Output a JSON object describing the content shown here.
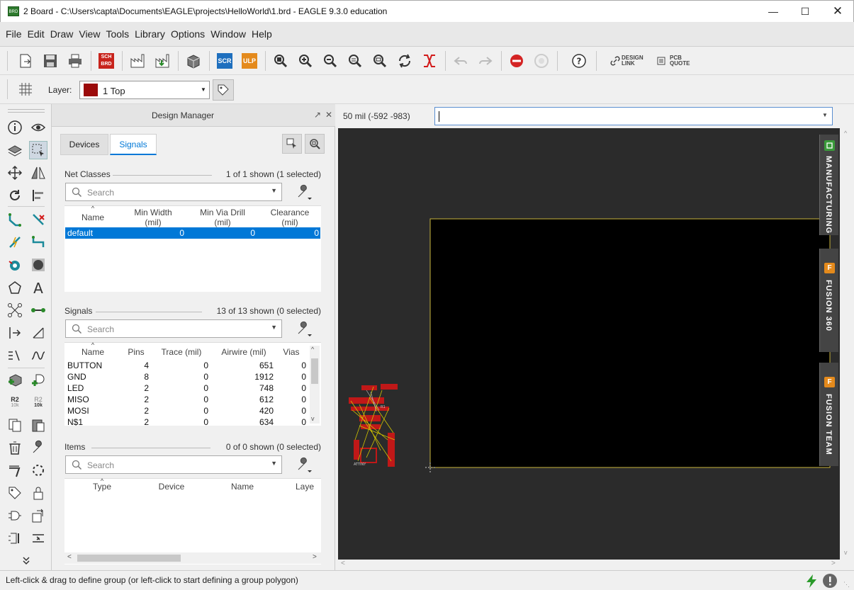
{
  "window": {
    "title": "2 Board - C:\\Users\\capta\\Documents\\EAGLE\\projects\\HelloWorld\\1.brd - EAGLE 9.3.0 education"
  },
  "menu": [
    "File",
    "Edit",
    "Draw",
    "View",
    "Tools",
    "Library",
    "Options",
    "Window",
    "Help"
  ],
  "toolbar": {
    "sch_brd_label": "SCH BRD",
    "scr_label": "SCR",
    "ulp_label": "ULP",
    "design_link": "DESIGN LINK",
    "pcb_quote": "PCB QUOTE"
  },
  "layer": {
    "label": "Layer:",
    "value": "1 Top",
    "color": "#9b0a0a"
  },
  "design_manager": {
    "title": "Design Manager",
    "tabs": [
      "Devices",
      "Signals"
    ],
    "active_tab": "Signals",
    "net_classes": {
      "label": "Net Classes",
      "count": "1 of 1 shown (1 selected)",
      "search_placeholder": "Search",
      "columns": [
        "Name",
        "Min Width\n(mil)",
        "Min Via Drill\n(mil)",
        "Clearance\n(mil)"
      ],
      "rows": [
        {
          "name": "default",
          "min_width": "0",
          "min_via_drill": "0",
          "clearance": "0",
          "selected": true
        }
      ]
    },
    "signals": {
      "label": "Signals",
      "count": "13 of 13 shown (0 selected)",
      "search_placeholder": "Search",
      "columns": [
        "Name",
        "Pins",
        "Trace (mil)",
        "Airwire (mil)",
        "Vias"
      ],
      "rows": [
        {
          "name": "BUTTON",
          "pins": "4",
          "trace": "0",
          "airwire": "651",
          "vias": "0"
        },
        {
          "name": "GND",
          "pins": "8",
          "trace": "0",
          "airwire": "1912",
          "vias": "0"
        },
        {
          "name": "LED",
          "pins": "2",
          "trace": "0",
          "airwire": "748",
          "vias": "0"
        },
        {
          "name": "MISO",
          "pins": "2",
          "trace": "0",
          "airwire": "612",
          "vias": "0"
        },
        {
          "name": "MOSI",
          "pins": "2",
          "trace": "0",
          "airwire": "420",
          "vias": "0"
        },
        {
          "name": "N$1",
          "pins": "2",
          "trace": "0",
          "airwire": "634",
          "vias": "0"
        }
      ]
    },
    "items": {
      "label": "Items",
      "count": "0 of 0 shown (0 selected)",
      "search_placeholder": "Search",
      "columns": [
        "Type",
        "Device",
        "Name",
        "Laye"
      ]
    }
  },
  "canvas": {
    "coordinate": "50 mil (-592 -983)",
    "command_value": ""
  },
  "side_tabs": [
    "MANUFACTURING",
    "FUSION 360",
    "FUSION TEAM"
  ],
  "status": {
    "text": "Left-click & drag to define group (or left-click to start defining a group polygon)"
  },
  "colors": {
    "accent": "#0078d7",
    "board_outline": "#c8b43c",
    "board_bg": "#000000",
    "canvas_bg": "#2b2b2b",
    "pad": "#c01818"
  }
}
